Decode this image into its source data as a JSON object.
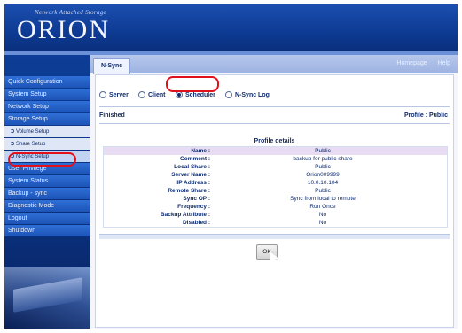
{
  "header": {
    "tagline": "Network Attached Storage",
    "logo_text": "ORION"
  },
  "sidebar": {
    "items": [
      {
        "label": "Quick Configuration"
      },
      {
        "label": "System Setup"
      },
      {
        "label": "Network Setup"
      },
      {
        "label": "Storage Setup"
      }
    ],
    "sub_items": [
      {
        "label": "Volume Setup"
      },
      {
        "label": "Share Setup"
      },
      {
        "label": "N-Sync Setup"
      }
    ],
    "items_after": [
      {
        "label": "User Privilege"
      },
      {
        "label": "System Status"
      },
      {
        "label": "Backup - sync"
      },
      {
        "label": "Diagnostic Mode"
      },
      {
        "label": "Logout"
      },
      {
        "label": "Shutdown"
      }
    ]
  },
  "main": {
    "tab": "N-Sync",
    "toplinks": [
      "Homepage",
      "Help"
    ],
    "radios": [
      {
        "label": "Server",
        "selected": false
      },
      {
        "label": "Client",
        "selected": false
      },
      {
        "label": "Scheduler",
        "selected": true
      },
      {
        "label": "N-Sync Log",
        "selected": false
      }
    ],
    "status": "Finished",
    "profile_label": "Profile : Public",
    "profile_title": "Profile details",
    "details": [
      {
        "label": "Name :",
        "value": "Public"
      },
      {
        "label": "Comment :",
        "value": "backup for public share"
      },
      {
        "label": "Local Share :",
        "value": "Public"
      },
      {
        "label": "Server Name :",
        "value": "Orion009999"
      },
      {
        "label": "IP Address :",
        "value": "10.0.10.104"
      },
      {
        "label": "Remote Share :",
        "value": "Public"
      },
      {
        "label": "Sync OP :",
        "value": "Sync from local to remote"
      },
      {
        "label": "Frequency :",
        "value": "Run Once"
      },
      {
        "label": "Backup Attribute :",
        "value": "No"
      },
      {
        "label": "Disabled :",
        "value": "No"
      }
    ],
    "ok_label": "OK"
  },
  "colors": {
    "frame": "#0b2a70",
    "highlight": "#e0101c",
    "menu": "#2f6fd6",
    "text": "#0f2c6d"
  }
}
